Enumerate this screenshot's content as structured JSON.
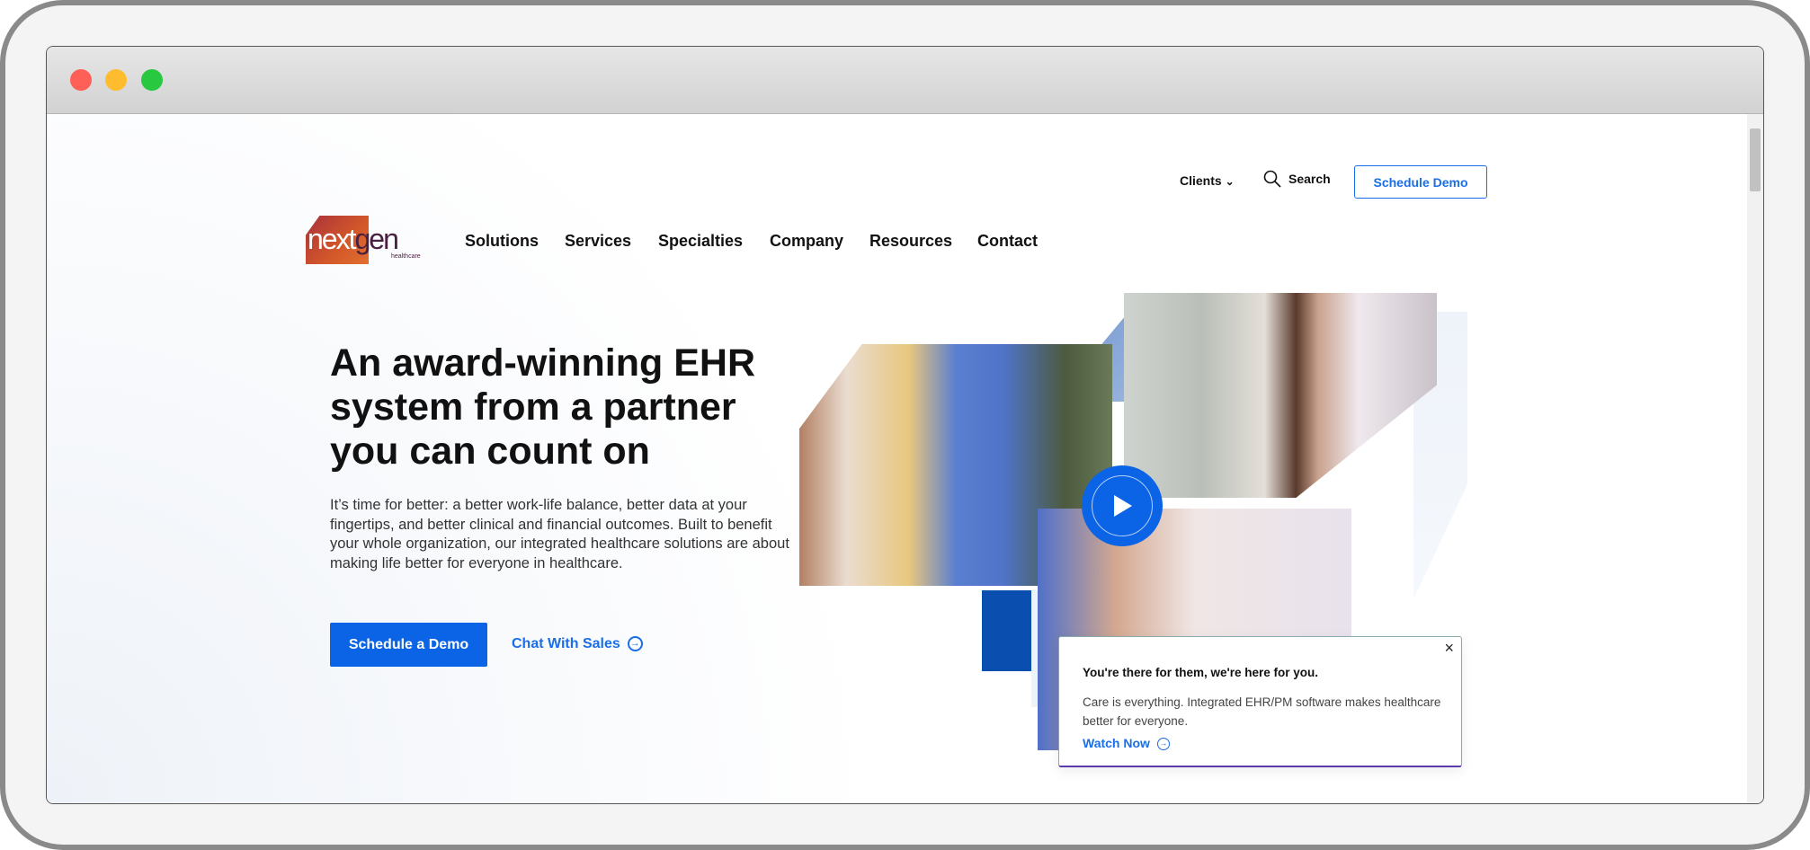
{
  "browser": {
    "controls": [
      "close",
      "minimize",
      "maximize"
    ]
  },
  "utility": {
    "clients": "Clients",
    "search": "Search",
    "schedule_demo": "Schedule Demo"
  },
  "logo": {
    "text": "nextgen",
    "sub": "healthcare"
  },
  "nav": [
    {
      "label": "Solutions"
    },
    {
      "label": "Services"
    },
    {
      "label": "Specialties"
    },
    {
      "label": "Company"
    },
    {
      "label": "Resources"
    },
    {
      "label": "Contact"
    }
  ],
  "hero": {
    "title": "An award-winning EHR system from a partner you can count on",
    "body": "It’s time for better: a better work-life balance, better data at your fingertips, and better clinical and financial outcomes. Built to benefit your whole organization, our integrated healthcare solutions are about making life better for everyone in healthcare.",
    "primary_cta": "Schedule a Demo",
    "secondary_cta": "Chat With Sales"
  },
  "video_card": {
    "title": "You're there for them, we're here for you.",
    "body": "Care is everything. Integrated EHR/PM software makes healthcare better for everyone.",
    "link": "Watch Now",
    "close": "×"
  },
  "colors": {
    "accent": "#0b63e5",
    "link": "#1a6ee8",
    "logo_orange": "#d4582a",
    "logo_red": "#a8303a",
    "logo_text": "#4a2040"
  }
}
